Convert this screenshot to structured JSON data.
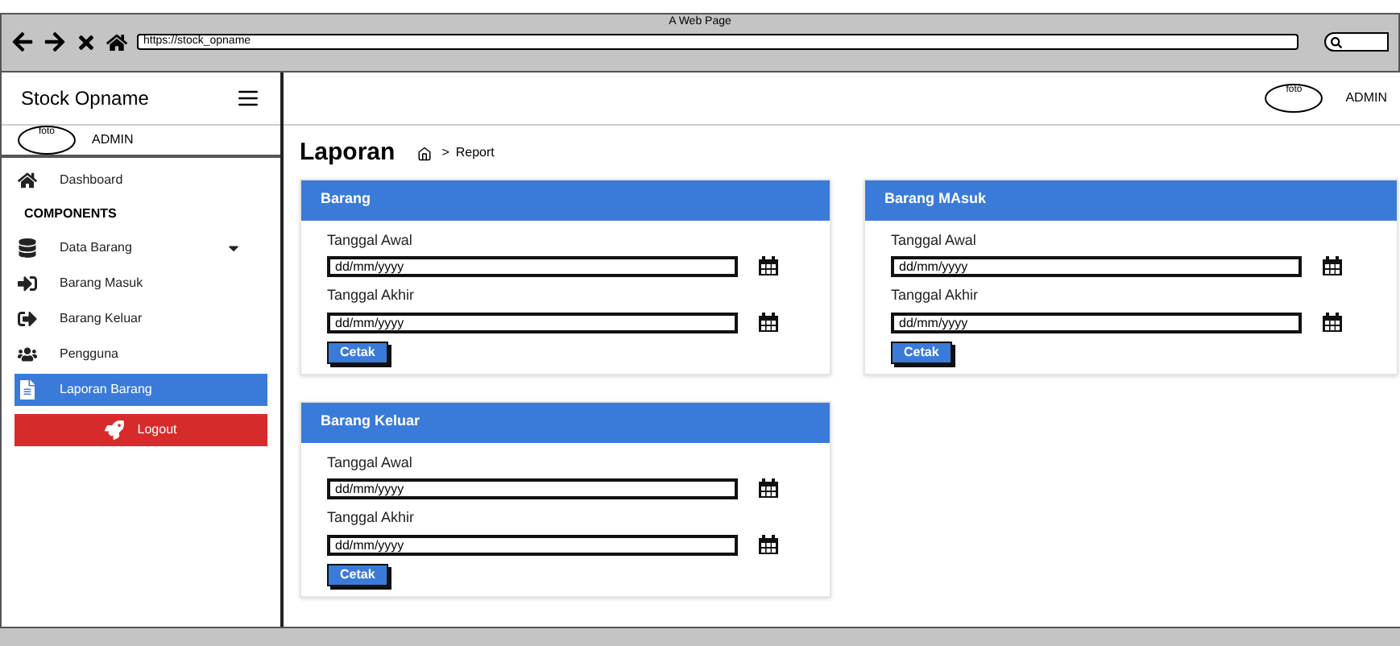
{
  "browser": {
    "title": "A Web Page",
    "url": "https://stock_opname"
  },
  "sidebar": {
    "brand": "Stock Opname",
    "user": {
      "avatar_label": "foto",
      "name": "ADMIN"
    },
    "items": [
      {
        "kind": "link",
        "label": "Dashboard",
        "selected": false
      },
      {
        "kind": "heading",
        "label": "COMPONENTS"
      },
      {
        "kind": "dropdown",
        "label": "Data Barang",
        "selected": false
      },
      {
        "kind": "link",
        "label": "Barang Masuk",
        "selected": false
      },
      {
        "kind": "link",
        "label": "Barang Keluar",
        "selected": false
      },
      {
        "kind": "link",
        "label": "Pengguna",
        "selected": false
      },
      {
        "kind": "link",
        "label": "Laporan Barang",
        "selected": true
      },
      {
        "kind": "logout",
        "label": "Logout"
      }
    ]
  },
  "header": {
    "avatar_label": "foto",
    "user": "ADMIN"
  },
  "page": {
    "title": "Laporan",
    "separator": ">",
    "breadcrumb": "Report"
  },
  "cards": [
    {
      "title": "Barang",
      "fields": [
        {
          "label": "Tanggal Awal",
          "value": "dd/mm/yyyy"
        },
        {
          "label": "Tanggal Akhir",
          "value": "dd/mm/yyyy"
        }
      ],
      "button": "Cetak"
    },
    {
      "title": "Barang MAsuk",
      "fields": [
        {
          "label": "Tanggal Awal",
          "value": "dd/mm/yyyy"
        },
        {
          "label": "Tanggal Akhir",
          "value": "dd/mm/yyyy"
        }
      ],
      "button": "Cetak"
    },
    {
      "title": "Barang Keluar",
      "fields": [
        {
          "label": "Tanggal Awal",
          "value": "dd/mm/yyyy"
        },
        {
          "label": "Tanggal Akhir",
          "value": "dd/mm/yyyy"
        }
      ],
      "button": "Cetak"
    }
  ]
}
